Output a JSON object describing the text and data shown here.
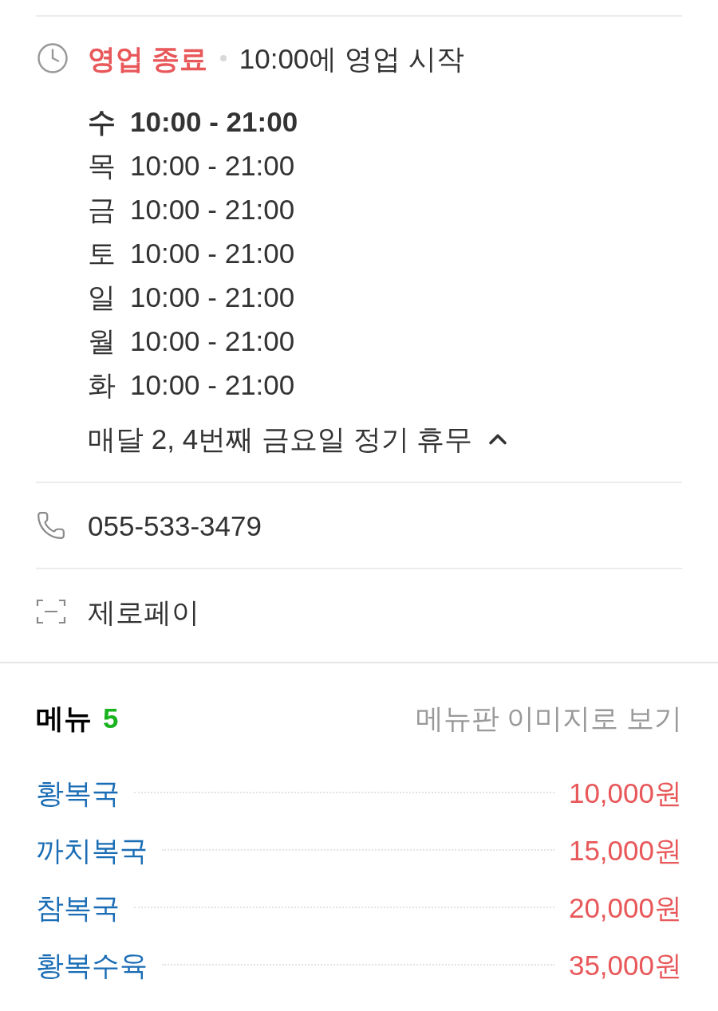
{
  "business_hours": {
    "status": {
      "label": "영업 종료",
      "open": false,
      "next": "10:00에 영업 시작"
    },
    "expanded": true,
    "days": [
      {
        "day": "수",
        "hours": "10:00 - 21:00",
        "today": true
      },
      {
        "day": "목",
        "hours": "10:00 - 21:00",
        "today": false
      },
      {
        "day": "금",
        "hours": "10:00 - 21:00",
        "today": false
      },
      {
        "day": "토",
        "hours": "10:00 - 21:00",
        "today": false
      },
      {
        "day": "일",
        "hours": "10:00 - 21:00",
        "today": false
      },
      {
        "day": "월",
        "hours": "10:00 - 21:00",
        "today": false
      },
      {
        "day": "화",
        "hours": "10:00 - 21:00",
        "today": false
      }
    ],
    "note": "매달 2, 4번째 금요일 정기 휴무"
  },
  "phone": "055-533-3479",
  "payment": "제로페이",
  "menu": {
    "title": "메뉴",
    "count": "5",
    "image_link": "메뉴판 이미지로 보기",
    "items": [
      {
        "name": "황복국",
        "price": "10,000원"
      },
      {
        "name": "까치복국",
        "price": "15,000원"
      },
      {
        "name": "참복국",
        "price": "20,000원"
      },
      {
        "name": "황복수육",
        "price": "35,000원"
      }
    ]
  }
}
